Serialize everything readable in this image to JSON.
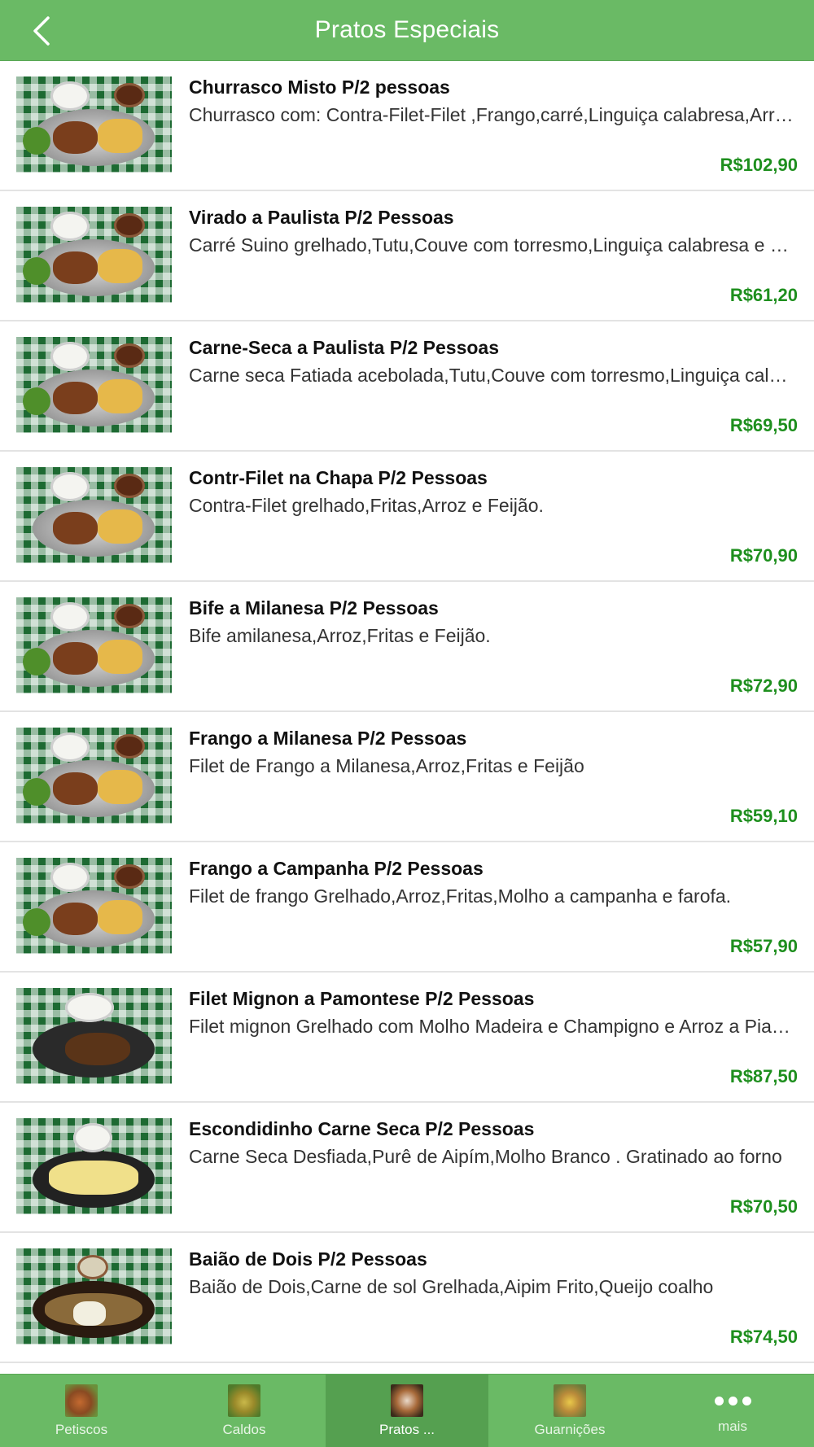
{
  "header": {
    "title": "Pratos Especiais",
    "back_icon": "chevron-left-icon"
  },
  "items": [
    {
      "name": "Churrasco Misto P/2 pessoas",
      "description": "Churrasco com: Contra-Filet-Filet ,Frango,carré,Linguiça calabresa,Arroz,Fritas e Feijão",
      "price": "R$102,90"
    },
    {
      "name": "Virado a Paulista P/2 Pessoas",
      "description": "Carré Suino grelhado,Tutu,Couve com torresmo,Linguiça calabresa e Banana",
      "price": "R$61,20"
    },
    {
      "name": "Carne-Seca a Paulista P/2 Pessoas",
      "description": "Carne seca Fatiada acebolada,Tutu,Couve com torresmo,Linguiça calabresa",
      "price": "R$69,50"
    },
    {
      "name": "Contr-Filet na Chapa P/2 Pessoas",
      "description": "Contra-Filet grelhado,Fritas,Arroz e Feijão.",
      "price": "R$70,90"
    },
    {
      "name": "Bife a Milanesa P/2 Pessoas",
      "description": "Bife amilanesa,Arroz,Fritas e Feijão.",
      "price": "R$72,90"
    },
    {
      "name": "Frango a Milanesa P/2 Pessoas",
      "description": "Filet de Frango a Milanesa,Arroz,Fritas e Feijão",
      "price": "R$59,10"
    },
    {
      "name": "Frango a Campanha P/2 Pessoas",
      "description": "Filet de frango Grelhado,Arroz,Fritas,Molho a campanha e farofa.",
      "price": "R$57,90"
    },
    {
      "name": "Filet Mignon a Pamontese P/2 Pessoas",
      "description": "Filet mignon Grelhado com Molho Madeira e Champigno e Arroz a Piamontese",
      "price": "R$87,50"
    },
    {
      "name": "Escondidinho Carne Seca P/2 Pessoas",
      "description": "Carne Seca Desfiada,Purê de Aipím,Molho Branco . Gratinado ao forno",
      "price": "R$70,50"
    },
    {
      "name": "Baião de Dois P/2 Pessoas",
      "description": "Baião de Dois,Carne de sol Grelhada,Aipim Frito,Queijo coalho",
      "price": "R$74,50"
    }
  ],
  "tabs": [
    {
      "label": "Petiscos",
      "icon": "petiscos-thumbnail-icon"
    },
    {
      "label": "Caldos",
      "icon": "caldos-thumbnail-icon"
    },
    {
      "label": "Pratos ...",
      "icon": "pratos-thumbnail-icon",
      "active": true
    },
    {
      "label": "Guarnições",
      "icon": "guarnicoes-thumbnail-icon"
    },
    {
      "label": "mais",
      "icon": "more-dots-icon"
    }
  ],
  "colors": {
    "header_bg": "#6aba65",
    "price": "#1e8f1e",
    "tab_active_bg": "#55a050"
  }
}
